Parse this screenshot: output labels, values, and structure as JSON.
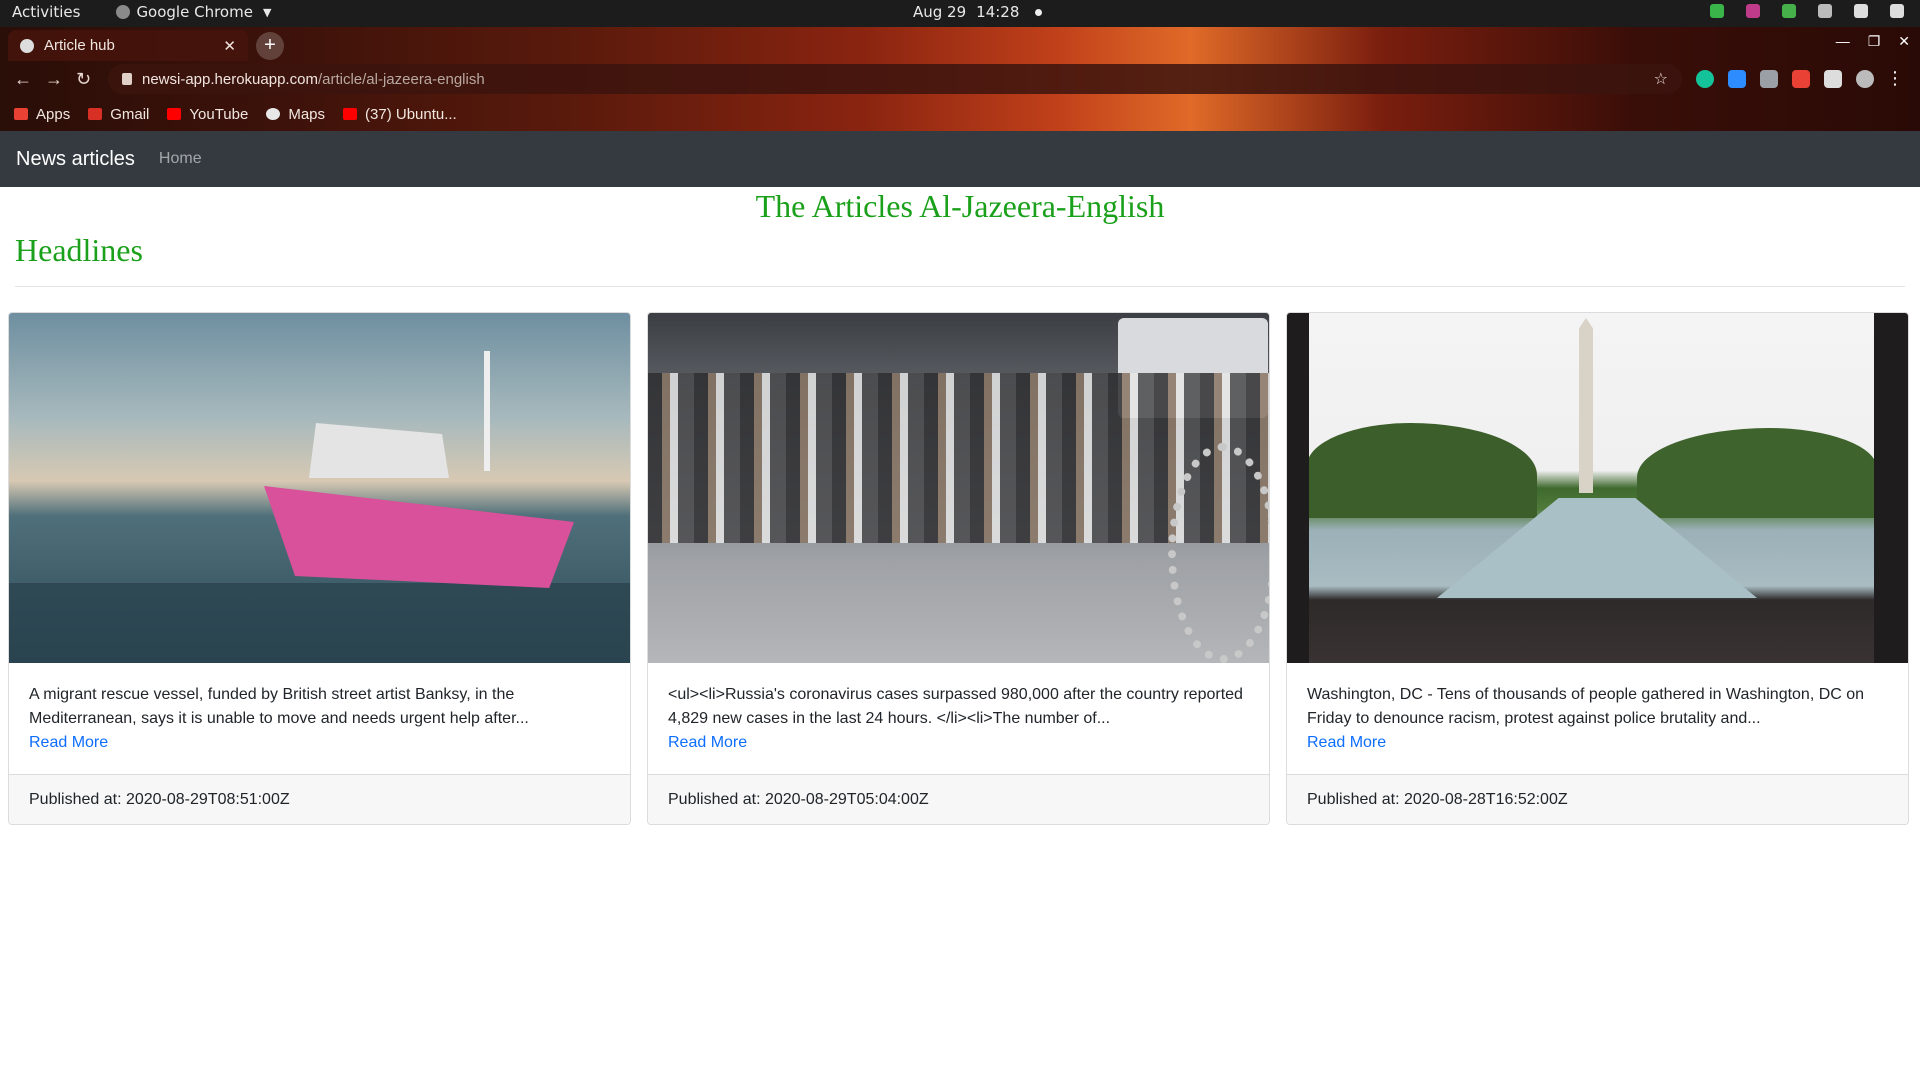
{
  "os": {
    "activities": "Activities",
    "app_name": "Google Chrome",
    "date": "Aug 29",
    "time": "14:28"
  },
  "browser": {
    "tab_title": "Article hub",
    "url_host": "newsi-app.herokuapp.com",
    "url_path": "/article/al-jazeera-english",
    "bookmarks": [
      "Apps",
      "Gmail",
      "YouTube",
      "Maps",
      "(37) Ubuntu..."
    ]
  },
  "navbar": {
    "brand": "News articles",
    "home": "Home"
  },
  "page": {
    "title": "The Articles Al-Jazeera-English",
    "section_heading": "Headlines"
  },
  "articles": [
    {
      "description": "A migrant rescue vessel, funded by British street artist Banksy, in the Mediterranean, says it is unable to move and needs urgent help after...",
      "read_more": "Read More",
      "published": "Published at: 2020-08-29T08:51:00Z"
    },
    {
      "description": "<ul><li>Russia's coronavirus cases surpassed 980,000 after the country reported 4,829 new cases in the last 24 hours. </li><li>The number of...",
      "read_more": "Read More",
      "published": "Published at: 2020-08-29T05:04:00Z"
    },
    {
      "description": "Washington, DC - Tens of thousands of people gathered in Washington, DC on Friday to denounce racism, protest against police brutality and...",
      "read_more": "Read More",
      "published": "Published at: 2020-08-28T16:52:00Z"
    }
  ],
  "colors": {
    "heading_green": "#1aa01a",
    "navbar_bg": "#343a40",
    "link_blue": "#0d6efd"
  }
}
